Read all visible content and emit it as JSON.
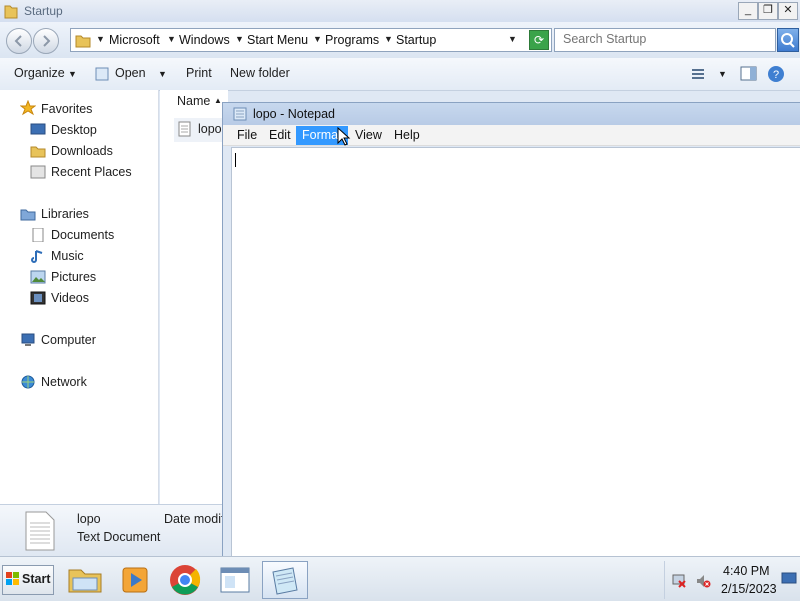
{
  "explorer": {
    "title": "Startup",
    "window_controls": [
      "_",
      "❐",
      "✕"
    ],
    "breadcrumb": [
      "Microsoft",
      "Windows",
      "Start Menu",
      "Programs",
      "Startup"
    ],
    "search_placeholder": "Search Startup",
    "toolbar": {
      "organize": "Organize",
      "open": "Open",
      "print": "Print",
      "new_folder": "New folder"
    },
    "nav": {
      "favorites": "Favorites",
      "desktop": "Desktop",
      "downloads": "Downloads",
      "recent_places": "Recent Places",
      "libraries": "Libraries",
      "documents": "Documents",
      "music": "Music",
      "pictures": "Pictures",
      "videos": "Videos",
      "computer": "Computer",
      "network": "Network"
    },
    "column_name": "Name",
    "file_name": "lopo",
    "details": {
      "name": "lopo",
      "type": "Text Document",
      "date_label": "Date modif"
    }
  },
  "notepad": {
    "title": "lopo - Notepad",
    "menu": [
      "File",
      "Edit",
      "Format",
      "View",
      "Help"
    ],
    "selected_menu": "Format",
    "content": ""
  },
  "taskbar": {
    "start": "Start",
    "apps": [
      "explorer-icon",
      "media-player-icon",
      "chrome-icon",
      "window-icon",
      "notepad-icon"
    ],
    "time": "4:40 PM",
    "date": "2/15/2023"
  },
  "colors": {
    "selection": "#3399ff",
    "window_frame": "#dfe8f4"
  }
}
